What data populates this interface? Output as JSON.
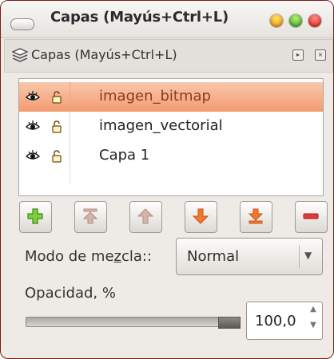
{
  "window": {
    "title": "Capas (Mayús+Ctrl+L)",
    "colors": {
      "frame": "#7d1b16",
      "selection": "#f39b72",
      "selection_text": "#8a3b1b"
    }
  },
  "panel": {
    "title": "Capas (Mayús+Ctrl+L)",
    "icons": [
      "layers-icon",
      "panel-menu-icon",
      "panel-close-icon"
    ]
  },
  "layers": [
    {
      "name": "imagen_bitmap",
      "visible": true,
      "locked": false,
      "selected": true
    },
    {
      "name": "imagen_vectorial",
      "visible": true,
      "locked": false,
      "selected": false
    },
    {
      "name": "Capa 1",
      "visible": true,
      "locked": false,
      "selected": false
    }
  ],
  "toolbar": {
    "buttons": [
      "new-layer-icon",
      "raise-to-top-icon",
      "raise-layer-icon",
      "lower-layer-icon",
      "lower-to-bottom-icon",
      "delete-layer-icon"
    ]
  },
  "blend": {
    "label_pre": "Modo de me",
    "label_mnemonic": "z",
    "label_post": "cla::",
    "value": "Normal"
  },
  "opacity": {
    "label": "Opacidad, %",
    "value": "100,0",
    "level": 1.0
  }
}
